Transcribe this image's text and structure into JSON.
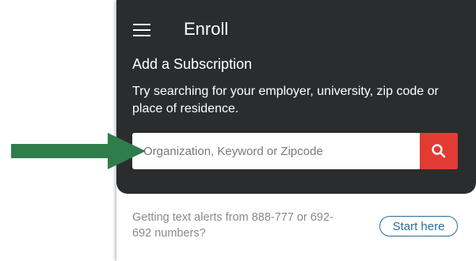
{
  "header": {
    "title": "Enroll",
    "menu_icon": "hamburger-menu-icon"
  },
  "subscription": {
    "heading": "Add a Subscription",
    "description": "Try searching for your employer, university, zip code or place of residence."
  },
  "search": {
    "placeholder": "Organization, Keyword or Zipcode",
    "value": "",
    "button_icon": "search-icon"
  },
  "footer": {
    "text": "Getting text alerts from 888-777 or 692-692 numbers?",
    "start_label": "Start here"
  },
  "annotation": {
    "arrow_icon": "right-arrow-icon"
  },
  "colors": {
    "header_bg": "#2b2c2e",
    "search_button": "#e23b34",
    "accent_blue": "#2a6f9a",
    "arrow_green": "#2e7d4a"
  }
}
